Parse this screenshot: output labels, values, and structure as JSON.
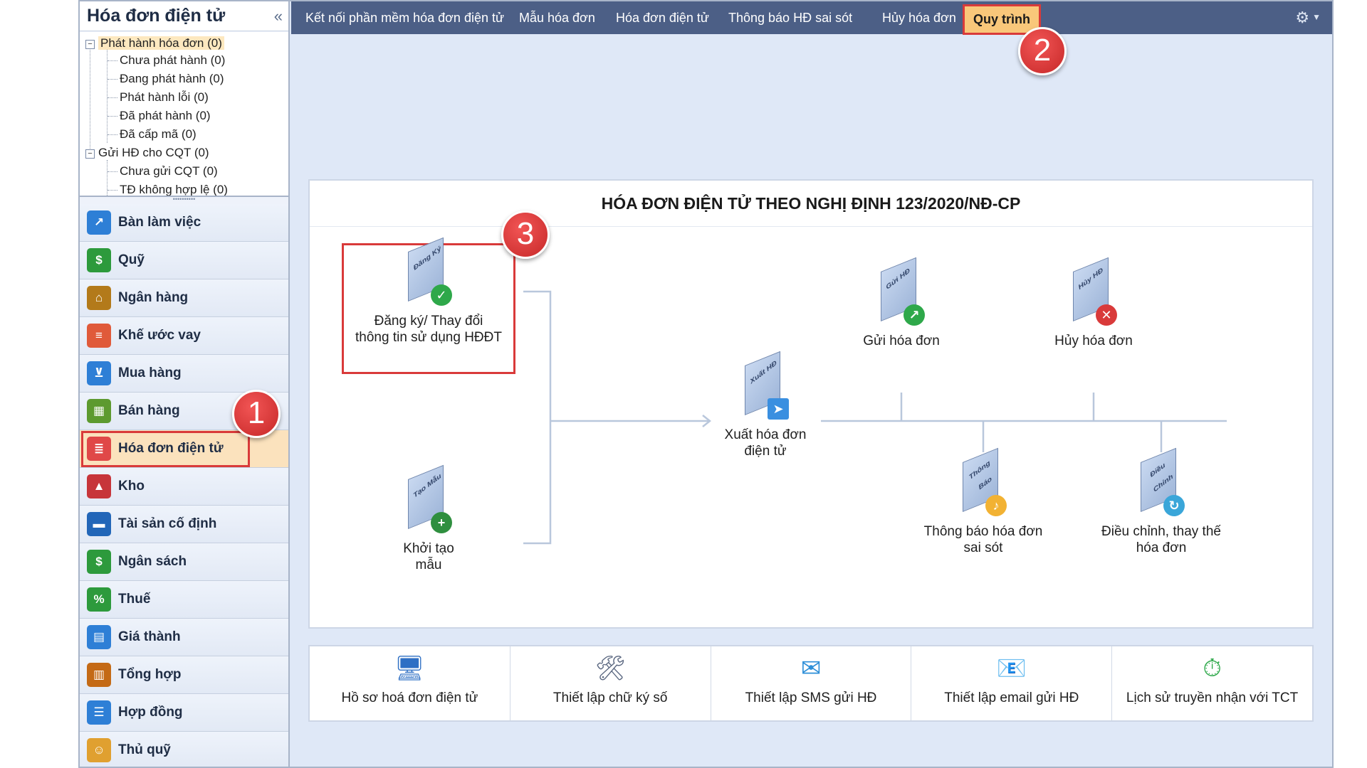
{
  "sidebar": {
    "title": "Hóa đơn điện tử",
    "collapse_icon": "«",
    "tree": [
      {
        "label": "Phát hành hóa đơn (0)",
        "level": 0,
        "expanded": true,
        "selected": true
      },
      {
        "label": "Chưa phát hành (0)",
        "level": 1
      },
      {
        "label": "Đang phát hành (0)",
        "level": 1
      },
      {
        "label": "Phát hành lỗi (0)",
        "level": 1
      },
      {
        "label": "Đã phát hành (0)",
        "level": 1
      },
      {
        "label": "Đã cấp mã (0)",
        "level": 1
      },
      {
        "label": "Gửi HĐ cho CQT (0)",
        "level": 0,
        "expanded": true
      },
      {
        "label": "Chưa gửi CQT (0)",
        "level": 1
      },
      {
        "label": "TĐ không hợp lệ (0)",
        "level": 1
      }
    ],
    "modules": [
      {
        "label": "Bàn làm việc",
        "icon": "chart-board-icon",
        "color": "#2e7fd6",
        "glyph": "↗"
      },
      {
        "label": "Quỹ",
        "icon": "cash-icon",
        "color": "#2d9a3c",
        "glyph": "$"
      },
      {
        "label": "Ngân hàng",
        "icon": "bank-icon",
        "color": "#b37a1a",
        "glyph": "⌂"
      },
      {
        "label": "Khế ước vay",
        "icon": "loan-icon",
        "color": "#e05a3a",
        "glyph": "≡"
      },
      {
        "label": "Mua hàng",
        "icon": "cart-icon",
        "color": "#2e7fd6",
        "glyph": "⊻"
      },
      {
        "label": "Bán hàng",
        "icon": "store-icon",
        "color": "#5d9a2f",
        "glyph": "▦"
      },
      {
        "label": "Hóa đơn điện tử",
        "icon": "e-invoice-icon",
        "color": "#e04848",
        "glyph": "≣",
        "active": true
      },
      {
        "label": "Kho",
        "icon": "warehouse-icon",
        "color": "#c7353a",
        "glyph": "▲"
      },
      {
        "label": "Tài sản cố định",
        "icon": "car-icon",
        "color": "#2266b8",
        "glyph": "▬"
      },
      {
        "label": "Ngân sách",
        "icon": "money-bag-icon",
        "color": "#2d9a3c",
        "glyph": "$"
      },
      {
        "label": "Thuế",
        "icon": "tax-icon",
        "color": "#2d9a3c",
        "glyph": "%"
      },
      {
        "label": "Giá thành",
        "icon": "cost-icon",
        "color": "#2e7fd6",
        "glyph": "▤"
      },
      {
        "label": "Tổng hợp",
        "icon": "book-icon",
        "color": "#c46a16",
        "glyph": "▥"
      },
      {
        "label": "Hợp đồng",
        "icon": "contract-icon",
        "color": "#2e7fd6",
        "glyph": "☰"
      },
      {
        "label": "Thủ quỹ",
        "icon": "cashier-icon",
        "color": "#e0a030",
        "glyph": "☺"
      }
    ]
  },
  "menubar": {
    "items": [
      "Kết nối phần mềm hóa đơn điện tử",
      "Mẫu hóa đơn",
      "Hóa đơn điện tử",
      "Thông báo HĐ sai sót",
      "Hủy hóa đơn"
    ],
    "active": "Quy trình",
    "settings_icon": "gear-icon"
  },
  "badges": [
    "1",
    "2",
    "3"
  ],
  "process": {
    "title": "HÓA ĐƠN ĐIỆN TỬ THEO NGHỊ ĐỊNH 123/2020/NĐ-CP",
    "nodes": {
      "register": {
        "line1": "Đăng ký/ Thay đổi",
        "line2": "thông tin sử dụng HĐĐT",
        "doc_text": "Đăng Ký"
      },
      "template": {
        "line1": "Khởi tạo",
        "line2": "mẫu",
        "doc_text": "Tạo Mẫu"
      },
      "issue": {
        "line1": "Xuất hóa đơn",
        "line2": "điện tử",
        "doc_text": "Xuất HĐ"
      },
      "send": {
        "line1": "Gửi hóa đơn",
        "line2": "",
        "doc_text": "Gửi HĐ"
      },
      "cancel": {
        "line1": "Hủy hóa đơn",
        "line2": "",
        "doc_text": "Hủy HĐ"
      },
      "notify": {
        "line1": "Thông báo hóa đơn",
        "line2": "sai sót",
        "doc_text": "Thông Báo"
      },
      "adjust": {
        "line1": "Điều chỉnh, thay thế",
        "line2": "hóa đơn",
        "doc_text": "Điều Chỉnh"
      }
    }
  },
  "tools": [
    {
      "label": "Hồ sơ hoá đơn điện tử",
      "icon": "profile-icon",
      "glyph": "🖥"
    },
    {
      "label": "Thiết lập chữ ký số",
      "icon": "tools-icon",
      "glyph": "🛠"
    },
    {
      "label": "Thiết lập SMS gửi HĐ",
      "icon": "sms-icon",
      "glyph": "✉"
    },
    {
      "label": "Thiết lập email gửi HĐ",
      "icon": "email-icon",
      "glyph": "📧"
    },
    {
      "label": "Lịch sử truyền nhận với TCT",
      "icon": "history-clock-icon",
      "glyph": "⏱"
    }
  ]
}
